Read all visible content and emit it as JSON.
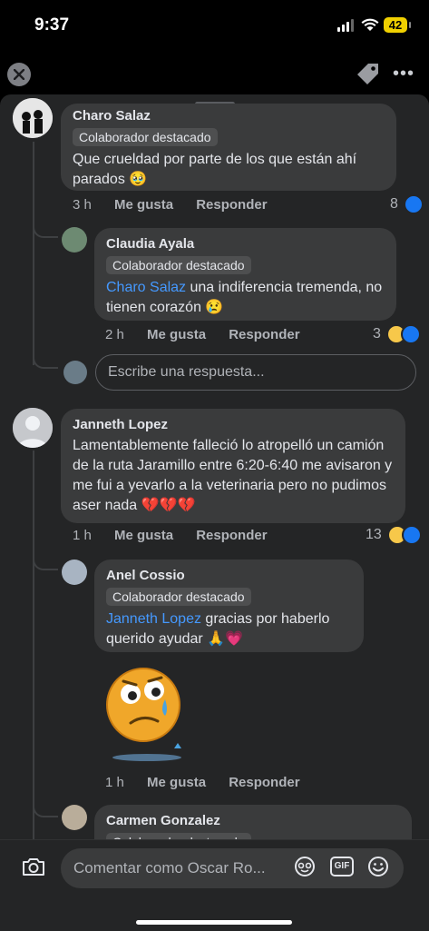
{
  "status": {
    "time": "9:37",
    "battery": "42"
  },
  "sheet": {
    "reply_placeholder": "Escribe una respuesta...",
    "comments": [
      {
        "author": "Charo Salaz",
        "badge": "Colaborador destacado",
        "text": "Que crueldad por parte de los que están ahí parados 🥹",
        "time": "3 h",
        "like": "Me gusta",
        "reply": "Responder",
        "reactions": "8"
      },
      {
        "author": "Claudia Ayala",
        "badge": "Colaborador destacado",
        "mention": "Charo Salaz",
        "text": " una indiferencia tremenda, no tienen corazón 😢",
        "time": "2 h",
        "like": "Me gusta",
        "reply": "Responder",
        "reactions": "3"
      },
      {
        "author": "Janneth Lopez",
        "text": "Lamentablemente falleció lo atropelló un camión de la ruta Jaramillo entre 6:20-6:40 me avisaron y me fui a yevarlo a la veterinaria pero no pudimos aser nada 💔💔💔",
        "time": "1 h",
        "like": "Me gusta",
        "reply": "Responder",
        "reactions": "13"
      },
      {
        "author": "Anel Cossio",
        "badge": "Colaborador destacado",
        "mention": "Janneth Lopez",
        "text": " gracias por haberlo querido ayudar 🙏💗",
        "time": "1 h",
        "like": "Me gusta",
        "reply": "Responder",
        "sticker": "sad-crying-face-sticker"
      },
      {
        "author": "Carmen Gonzalez",
        "badge": "Colaborador destacado"
      }
    ]
  },
  "footer": {
    "placeholder": "Comentar como Oscar Ro...",
    "gif": "GIF"
  }
}
